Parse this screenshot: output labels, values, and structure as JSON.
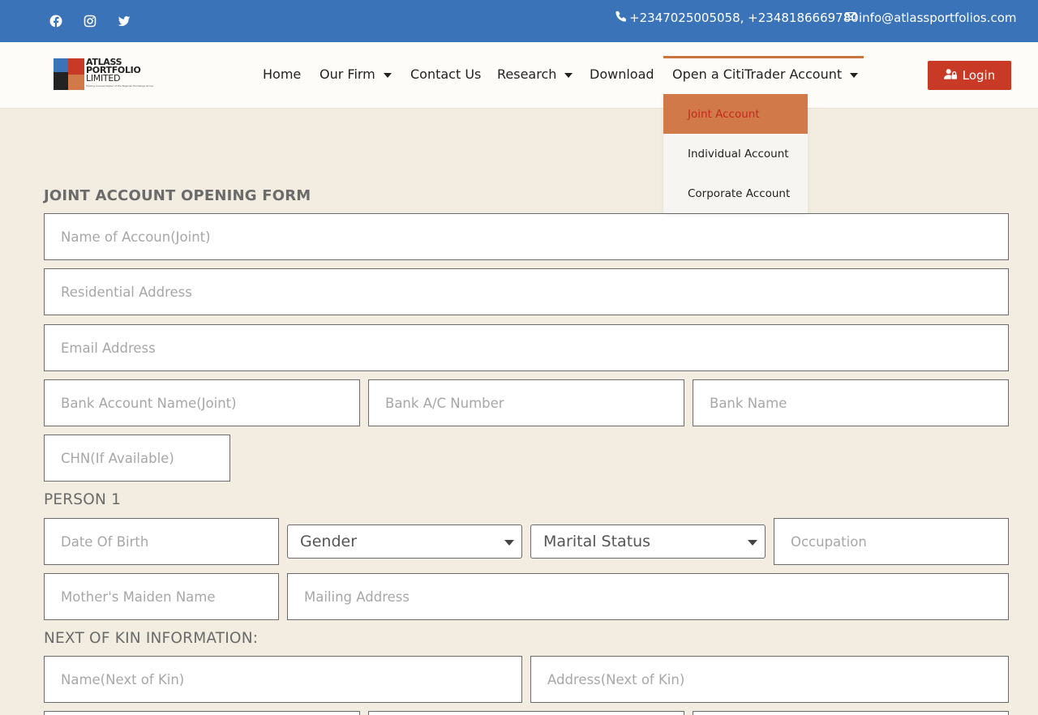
{
  "topbar": {
    "social_icons": [
      "facebook-icon",
      "instagram-icon",
      "twitter-icon"
    ],
    "phone": "+2347025005058, +2348186669780",
    "email": "info@atlassportfolios.com"
  },
  "logo": {
    "line1": "ATLASS",
    "line2": "PORTFOLIO",
    "line3": "LIMITED",
    "tagline": "Trading License Dealer of the Nigerian Exchange Group"
  },
  "nav": {
    "home": "Home",
    "our_firm": "Our Firm",
    "contact_us": "Contact Us",
    "research": "Research",
    "download": "Download",
    "open_account": "Open a CitiTrader Account"
  },
  "login": {
    "label": "Login"
  },
  "dropdown": {
    "items": [
      "Joint Account",
      "Individual Account",
      "Corporate Account"
    ],
    "active": "Joint Account"
  },
  "form": {
    "title": "JOINT ACCOUNT OPENING FORM",
    "account_name_ph": "Name of Accoun(Joint)",
    "residential_address_ph": "Residential Address",
    "email_ph": "Email Address",
    "bank_account_name_ph": "Bank Account Name(Joint)",
    "bank_ac_number_ph": "Bank A/C Number",
    "bank_name_ph": "Bank Name",
    "chn_ph": "CHN(If Available)",
    "person1_label": "PERSON 1",
    "dob_ph": "Date Of Birth",
    "gender_value": "Gender",
    "marital_status_value": "Marital Status",
    "occupation_ph": "Occupation",
    "mothers_maiden_name_ph": "Mother's Maiden Name",
    "mailing_address_ph": "Mailing Address",
    "next_of_kin_label": "NEXT OF KIN INFORMATION:",
    "nok_name_ph": "Name(Next of Kin)",
    "nok_address_ph": "Address(Next of Kin)"
  },
  "colors": {
    "topbar": "#3a73b8",
    "page_bg": "#f2ede0",
    "login_btn": "#c83a25",
    "dropdown_active_bg": "#d2794a",
    "dropdown_active_text": "#c12b1a",
    "nav_active_line": "#c9733f"
  }
}
